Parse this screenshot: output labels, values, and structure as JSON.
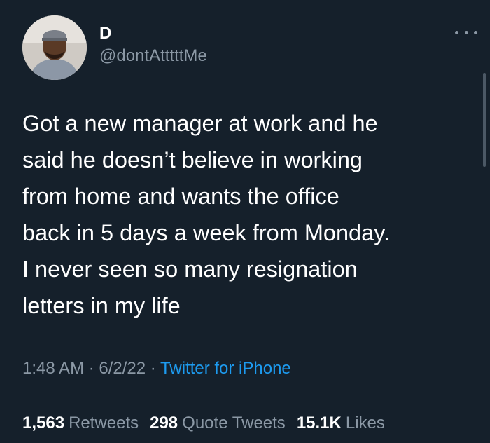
{
  "author": {
    "display_name": "D",
    "handle": "@dontAtttttMe"
  },
  "tweet": {
    "text": "Got a new manager at work and he\nsaid he doesn’t believe in working\nfrom home and wants the office\nback in 5 days a week from Monday.\nI never seen so many resignation\nletters in my life",
    "time": "1:48 AM",
    "date": "6/2/22",
    "separator": " · ",
    "source": "Twitter for iPhone"
  },
  "stats": {
    "retweets_count": "1,563",
    "retweets_label": "Retweets",
    "quotes_count": "298",
    "quotes_label": "Quote Tweets",
    "likes_count": "15.1K",
    "likes_label": "Likes"
  },
  "icons": {
    "more": "more-horizontal-icon"
  },
  "colors": {
    "background": "#15202b",
    "primary_text": "#ffffff",
    "secondary_text": "#8b98a5",
    "link": "#1d9bf0",
    "divider": "#38444d"
  }
}
